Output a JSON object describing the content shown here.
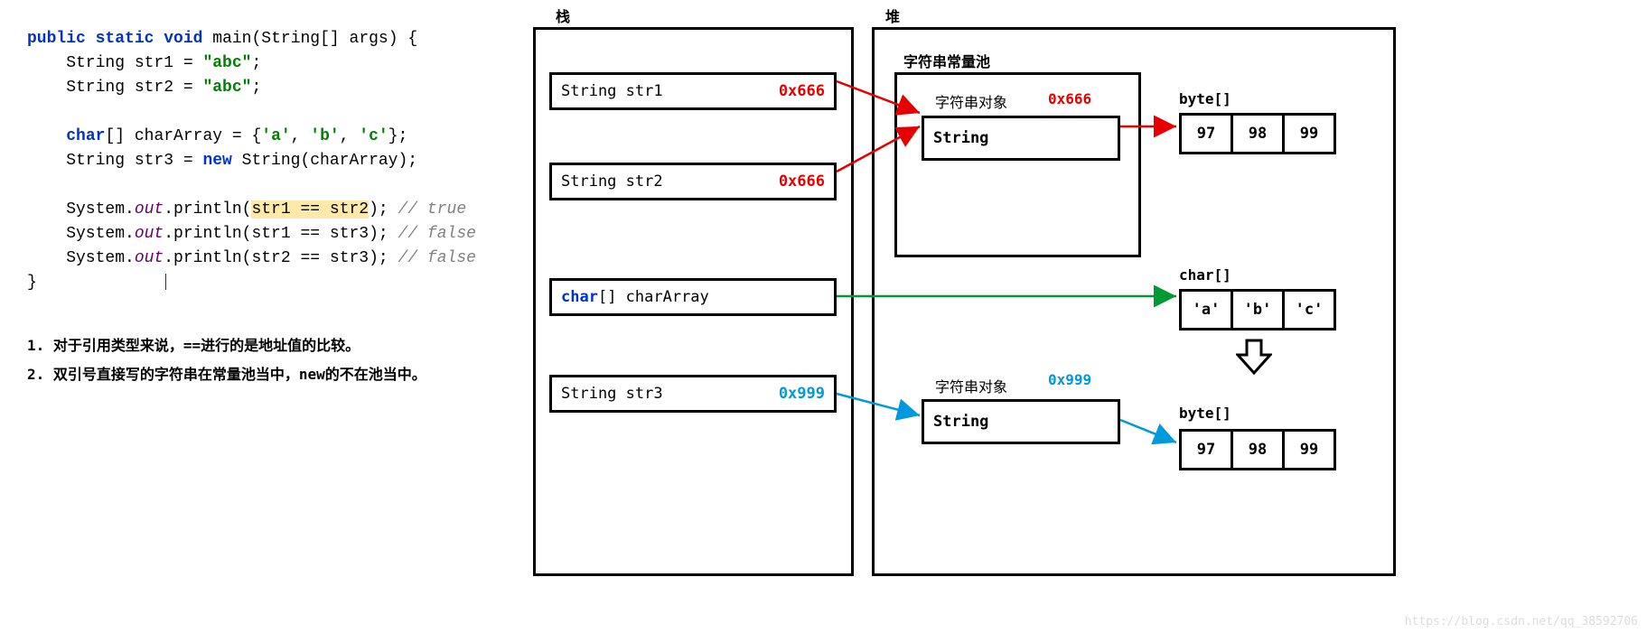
{
  "code": {
    "kw_public": "public",
    "kw_static": "static",
    "kw_void": "void",
    "kw_main": "main",
    "kw_args": "(String[] args) {",
    "line2_a": "    String str1 = ",
    "line2_b": "\"abc\"",
    "line2_c": ";",
    "line3_a": "    String str2 = ",
    "line3_b": "\"abc\"",
    "line3_c": ";",
    "line5_a": "    ",
    "line5_kw": "char",
    "line5_b": "[] charArray = {",
    "line5_s1": "'a'",
    "line5_c1": ", ",
    "line5_s2": "'b'",
    "line5_c2": ", ",
    "line5_s3": "'c'",
    "line5_c3": "};",
    "line6_a": "    String str3 = ",
    "line6_kw": "new",
    "line6_b": " String(charArray);",
    "out": "out",
    "println": ".println(",
    "sys": "    System.",
    "eq": " == ",
    "v1a": "str1",
    "v1b": "str2",
    "c1": "); ",
    "cm1": "// true",
    "v2a": "str1",
    "v2b": "str3",
    "cm2": "// false",
    "v3a": "str2",
    "v3b": "str3",
    "cm3": "// false",
    "close": "}"
  },
  "notes": {
    "n1": "1. 对于引用类型来说，==进行的是地址值的比较。",
    "n2": "2. 双引号直接写的字符串在常量池当中，new的不在池当中。"
  },
  "diagram": {
    "stack_label": "栈",
    "heap_label": "堆",
    "str1": {
      "name": "String str1",
      "addr": "0x666"
    },
    "str2": {
      "name": "String str2",
      "addr": "0x666"
    },
    "charArr": {
      "kw": "char",
      "rest": "[] charArray"
    },
    "str3": {
      "name": "String str3",
      "addr": "0x999"
    },
    "pool_label": "字符串常量池",
    "obj_label_1": "字符串对象",
    "pool_addr": "0x666",
    "pool_type": "String",
    "byte_label_1": "byte[]",
    "bytes_1": [
      "97",
      "98",
      "99"
    ],
    "char_label": "char[]",
    "chars": [
      "'a'",
      "'b'",
      "'c'"
    ],
    "obj_label_2": "字符串对象",
    "heap_addr": "0x999",
    "heap_type": "String",
    "byte_label_2": "byte[]",
    "bytes_2": [
      "97",
      "98",
      "99"
    ]
  },
  "watermark": "https://blog.csdn.net/qq_38592706"
}
